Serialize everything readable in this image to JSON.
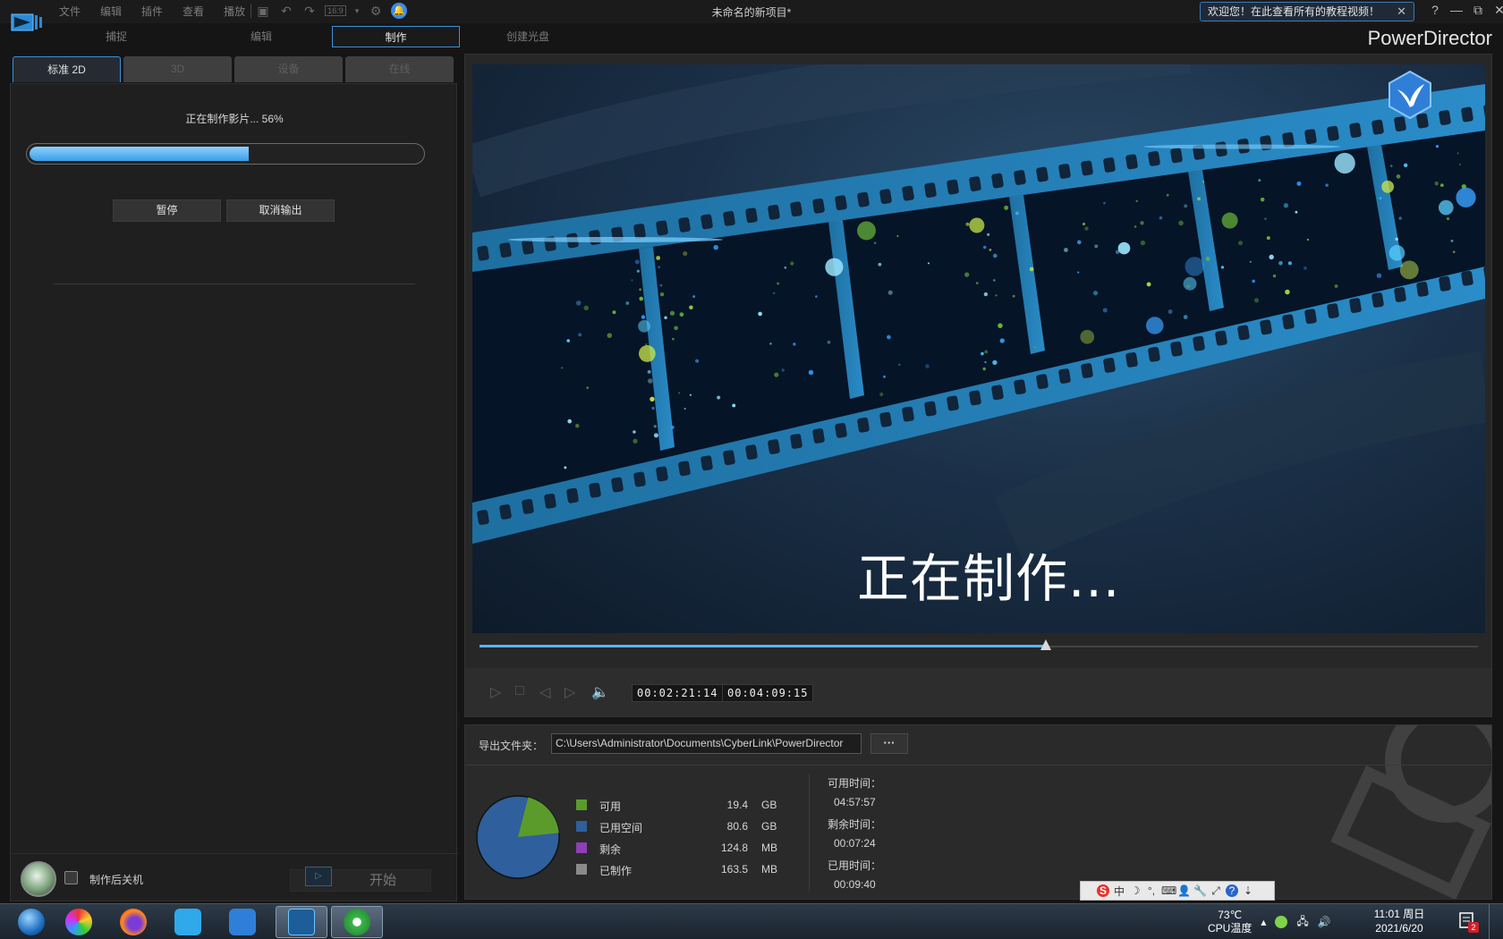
{
  "window": {
    "title": "未命名的新项目*",
    "welcome": "欢迎您！在此查看所有的教程视频！",
    "welcome_close": "✕",
    "brand": "PowerDirector",
    "help": "?",
    "minimize": "—",
    "restore": "⧉",
    "close": "✕"
  },
  "menu": [
    "文件",
    "编辑",
    "插件",
    "查看",
    "播放"
  ],
  "toolbar": {
    "aspect": "16:9"
  },
  "modes": {
    "capture": "捕捉",
    "edit": "编辑",
    "produce": "制作",
    "disc": "创建光盘"
  },
  "subtabs": [
    "标准 2D",
    "3D",
    "设备",
    "在线"
  ],
  "progress": {
    "text": "正在制作影片... 56%",
    "fraction": 0.56,
    "pause": "暂停",
    "cancel": "取消输出"
  },
  "footer": {
    "shutdown_label": "制作后关机",
    "shutdown_checked": false,
    "start": "开始"
  },
  "preview": {
    "overlay": "正在制作...",
    "scrub_fraction": 0.567,
    "current_time": "00:02:21:14",
    "total_time": "00:04:09:15"
  },
  "output": {
    "folder_label": "导出文件夹：",
    "folder_path": "C:\\Users\\Administrator\\Documents\\CyberLink\\PowerDirector",
    "browse": "···",
    "disk": [
      {
        "name": "可用",
        "value": "19.4",
        "unit": "GB",
        "color": "#5b9b2c"
      },
      {
        "name": "已用空间",
        "value": "80.6",
        "unit": "GB",
        "color": "#2f5f9c"
      },
      {
        "name": "剩余",
        "value": "124.8",
        "unit": "MB",
        "color": "#8e3fb5"
      },
      {
        "name": "已制作",
        "value": "163.5",
        "unit": "MB",
        "color": "#8a8a8a"
      }
    ],
    "available_time_label": "可用时间：",
    "available_time": "04:57:57",
    "remaining_time_label": "剩余时间：",
    "remaining_time": "00:07:24",
    "elapsed_time_label": "已用时间：",
    "elapsed_time": "00:09:40"
  },
  "ime": [
    "S",
    "中",
    "☽",
    "°,",
    "⌨",
    "👤",
    "🔧",
    "⤢",
    "?",
    "⇣"
  ],
  "taskbar": {
    "temp": "73℃",
    "temp_label": "CPU温度",
    "time": "11:01 周日",
    "date": "2021/6/20",
    "notify_count": "2"
  }
}
